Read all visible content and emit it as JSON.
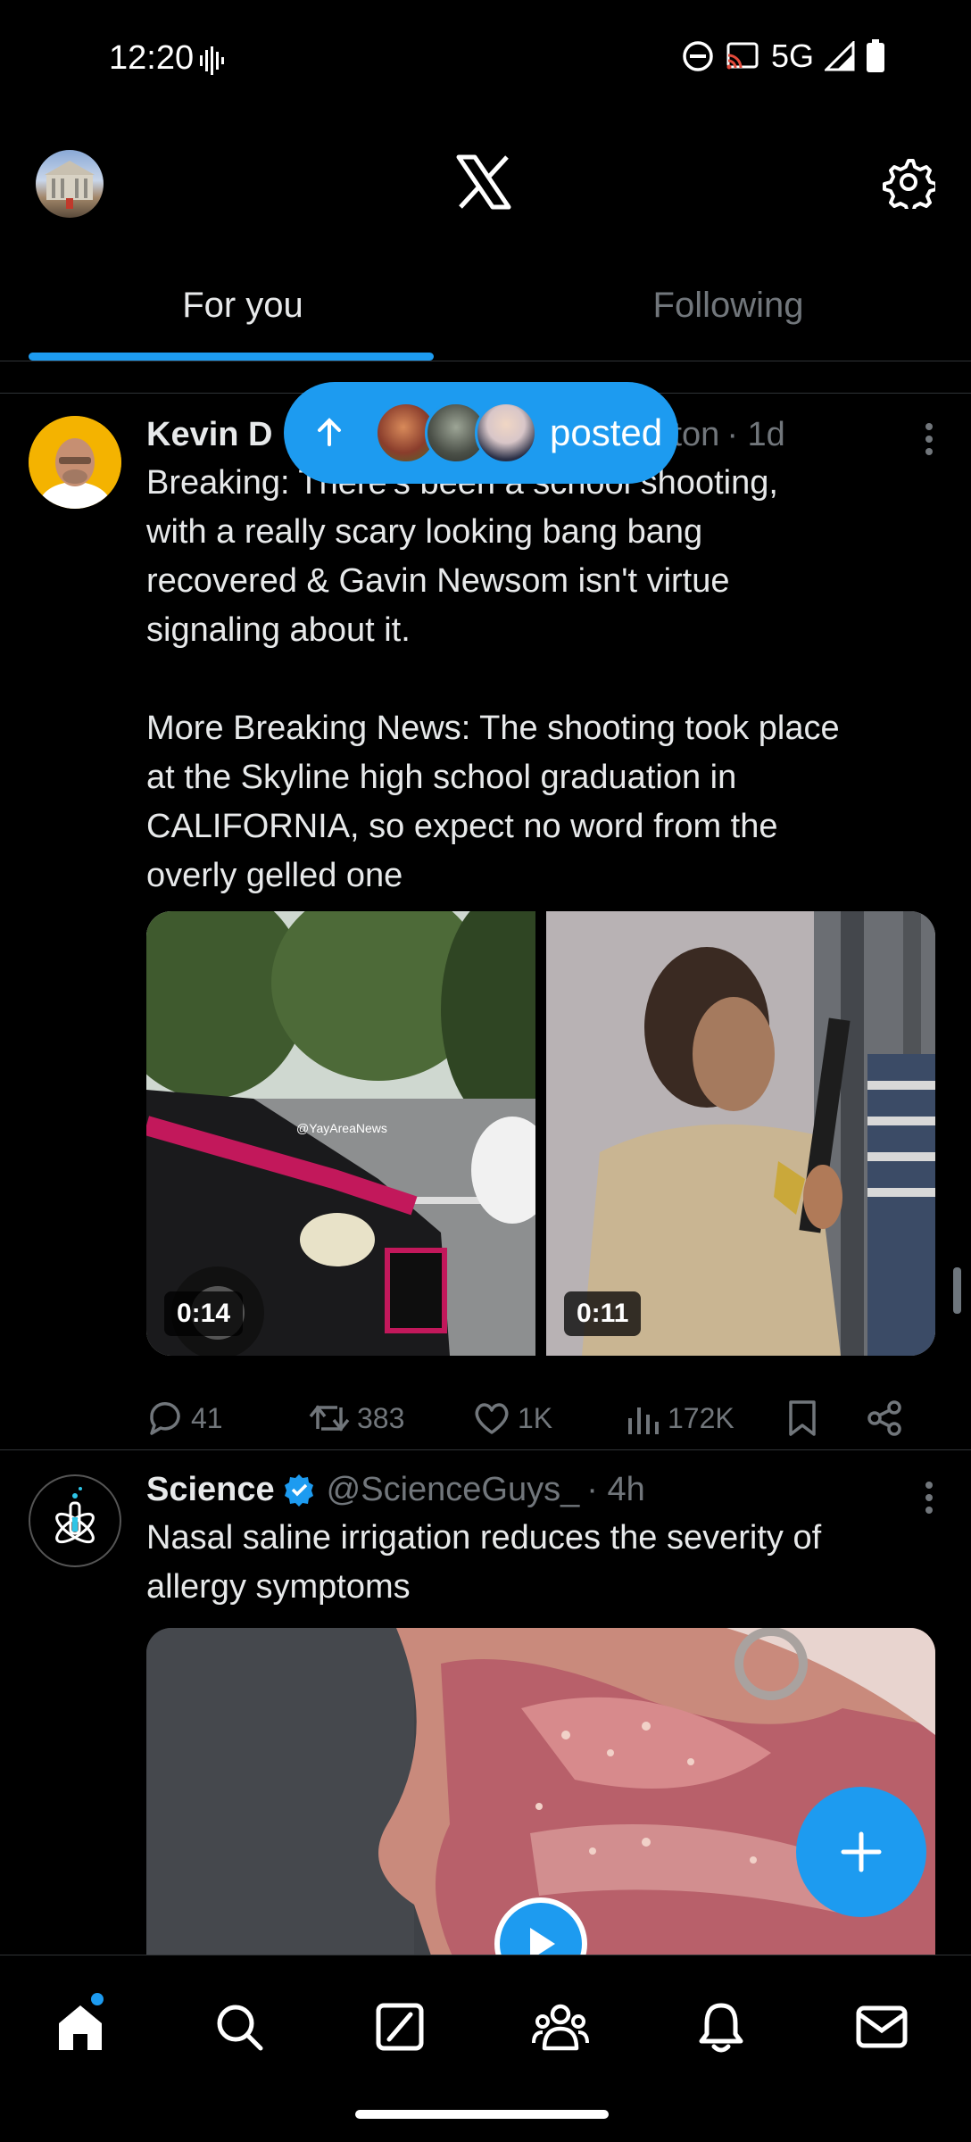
{
  "status_bar": {
    "time": "12:20",
    "network": "5G"
  },
  "tabs": [
    {
      "label": "For you",
      "active": true
    },
    {
      "label": "Following",
      "active": false
    }
  ],
  "new_posts_pill": {
    "label": "posted"
  },
  "posts": [
    {
      "name": "Kevin D",
      "handle_tail": "ton",
      "time": "· 1d",
      "text_line1": "Breaking: There's been a school shooting,",
      "text_rest": "with a really scary looking bang bang\nrecovered & Gavin Newsom isn't virtue\nsignaling about it.\n\nMore Breaking News: The shooting took place\nat the Skyline high school graduation in\nCALIFORNIA, so expect no word from the\noverly gelled one",
      "media": [
        {
          "duration": "0:14",
          "watermark": "@YayAreaNews"
        },
        {
          "duration": "0:11"
        }
      ],
      "stats": {
        "replies": "41",
        "reposts": "383",
        "likes": "1K",
        "views": "172K"
      }
    },
    {
      "name": "Science",
      "handle": "@ScienceGuys_",
      "time": "· 4h",
      "text": "Nasal saline irrigation reduces the severity of\nallergy symptoms"
    }
  ],
  "colors": {
    "accent": "#1d9bf0",
    "background": "#000000",
    "muted": "#71767b",
    "text": "#e7e9ea"
  }
}
